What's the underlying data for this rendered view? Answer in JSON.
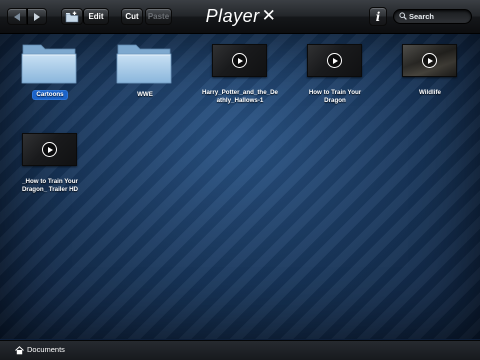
{
  "app": {
    "title": "Player",
    "title_mark": "✕"
  },
  "toolbar": {
    "edit_label": "Edit",
    "cut_label": "Cut",
    "paste_label": "Paste",
    "info_label": "i",
    "search_placeholder": "Search"
  },
  "files": [
    {
      "label": "Cartoons",
      "type": "folder",
      "selected": true
    },
    {
      "label": "WWE",
      "type": "folder",
      "selected": false
    },
    {
      "label": "Harry_Potter_and_the_Deathly_Hallows-1",
      "line1": "Harry_Potter_and_the_De",
      "line2": "athly_Hallows-1",
      "type": "video"
    },
    {
      "label": "How to Train Your Dragon",
      "line1": "How to Train Your",
      "line2": "Dragon",
      "type": "video"
    },
    {
      "label": "Wildlife",
      "type": "video"
    },
    {
      "label": "_How to Train Your Dragon_ Trailer HD",
      "line1": "_How to Train Your",
      "line2": "Dragon_ Trailer HD",
      "type": "video"
    }
  ],
  "bottombar": {
    "path": "Documents"
  },
  "colors": {
    "selection": "#1a63c9",
    "background": "#1a3a62",
    "folder": "#a9cdea"
  }
}
